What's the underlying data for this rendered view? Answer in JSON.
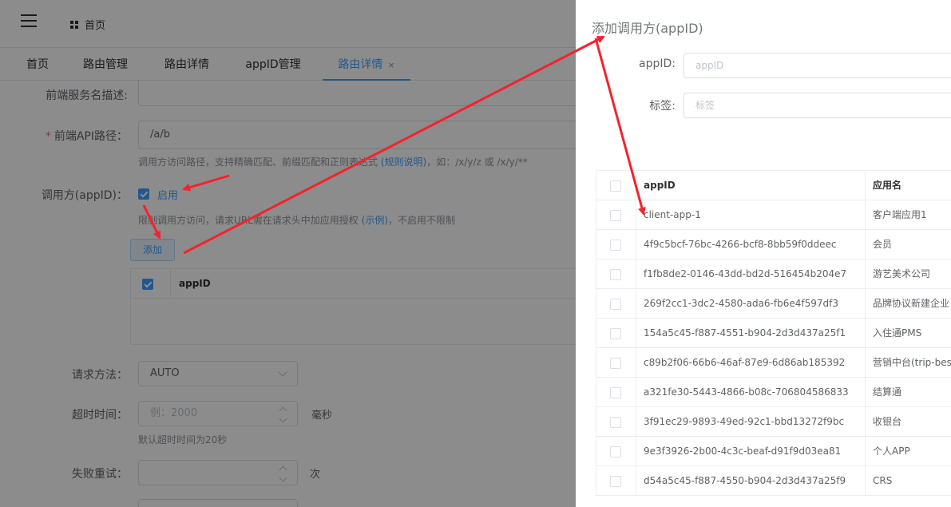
{
  "header": {
    "home": "首页"
  },
  "tabs": [
    {
      "label": "首页"
    },
    {
      "label": "路由管理"
    },
    {
      "label": "路由详情"
    },
    {
      "label": "appID管理"
    },
    {
      "label": "路由详情",
      "close": "×"
    }
  ],
  "form": {
    "desc_label": "前端服务名描述:",
    "api_path_label": "前端API路径：",
    "api_path_value": "/a/b",
    "api_path_hint_pre": "调用方访问路径，支持精确匹配、前缀匹配和正则表达式",
    "api_path_hint_link": "(规则说明)",
    "api_path_hint_post": "，如：/x/y/z 或 /x/y/**",
    "caller_label": "调用方(appID)：",
    "caller_enable": "启用",
    "caller_hint_pre": "限制调用方访问，请求URL需在请求头中加应用授权",
    "caller_hint_link": "(示例)",
    "caller_hint_post": "，不启用不限制",
    "add_button": "添加",
    "mini_table_header": "appID",
    "method_label": "请求方法：",
    "method_value": "AUTO",
    "timeout_label": "超时时间：",
    "timeout_placeholder": "例：2000",
    "timeout_unit": "毫秒",
    "timeout_hint": "默认超时时间为20秒",
    "retry_label": "失败重试：",
    "retry_unit": "次"
  },
  "drawer": {
    "title": "添加调用方(appID)",
    "appid_label": "appID:",
    "appid_placeholder": "appID",
    "tag_label": "标签:",
    "tag_placeholder": "标签",
    "table_headers": {
      "appid": "appID",
      "name": "应用名"
    },
    "rows": [
      {
        "appid": "client-app-1",
        "name": "客户端应用1"
      },
      {
        "appid": "4f9c5bcf-76bc-4266-bcf8-8bb59f0ddeec",
        "name": "会员"
      },
      {
        "appid": "f1fb8de2-0146-43dd-bd2d-516454b204e7",
        "name": "游艺美术公司"
      },
      {
        "appid": "269f2cc1-3dc2-4580-ada6-fb6e4f597df3",
        "name": "品牌协议新建企业"
      },
      {
        "appid": "154a5c45-f887-4551-b904-2d3d437a25f1",
        "name": "入住通PMS"
      },
      {
        "appid": "c89b2f06-66b6-46af-87e9-6d86ab185392",
        "name": "营销中台(trip-best"
      },
      {
        "appid": "a321fe30-5443-4866-b08c-706804586833",
        "name": "结算通"
      },
      {
        "appid": "3f91ec29-9893-49ed-92c1-bbd13272f9bc",
        "name": "收银台"
      },
      {
        "appid": "9e3f3926-2b00-4c3c-beaf-d91f9d03ea81",
        "name": "个人APP"
      },
      {
        "appid": "d54a5c45-f887-4550-b904-2d3d437a25f9",
        "name": "CRS"
      }
    ]
  },
  "colors": {
    "accent": "#409eff",
    "arrow": "#f5222d"
  }
}
